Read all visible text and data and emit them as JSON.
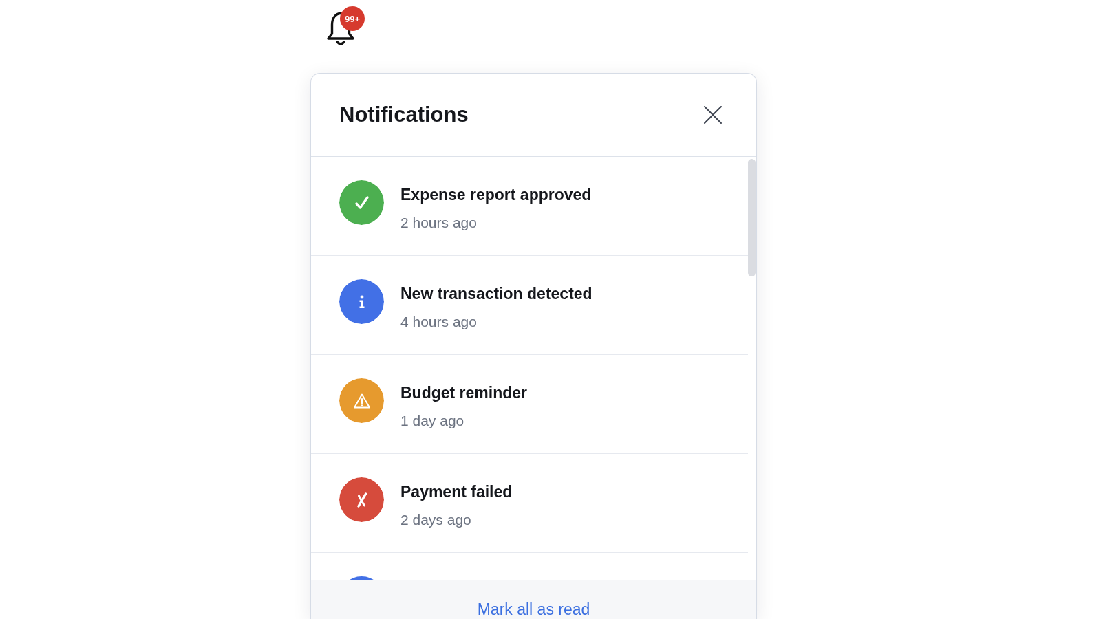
{
  "notification_bell": {
    "badge": "99+"
  },
  "panel": {
    "title": "Notifications"
  },
  "items": [
    {
      "kind": "success",
      "color": "#4caf50",
      "title": "Expense report approved",
      "time": "2 hours ago"
    },
    {
      "kind": "info",
      "color": "#4270e6",
      "title": "New transaction detected",
      "time": "4 hours ago"
    },
    {
      "kind": "warning",
      "color": "#e69a2e",
      "title": "Budget reminder",
      "time": "1 day ago"
    },
    {
      "kind": "error",
      "color": "#d64b3c",
      "title": "Payment failed",
      "time": "2 days ago"
    },
    {
      "kind": "info",
      "color": "#4270e6"
    }
  ],
  "footer": {
    "action": "Mark all as read"
  }
}
